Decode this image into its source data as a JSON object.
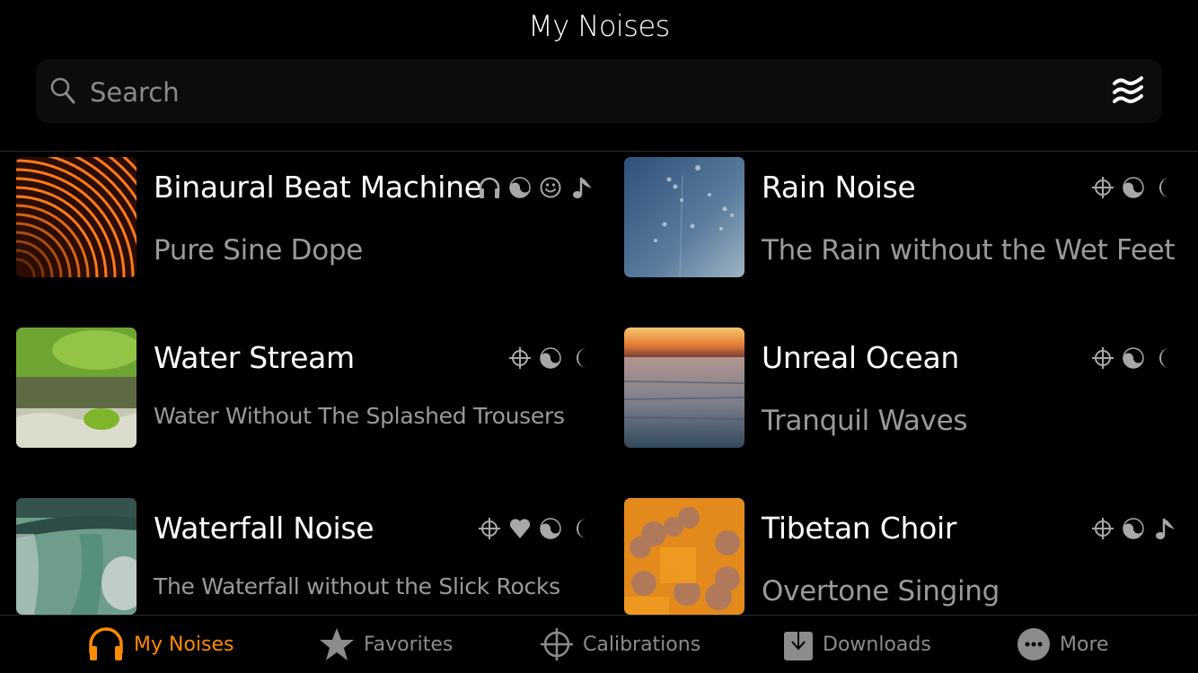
{
  "header": {
    "title": "My Noises"
  },
  "search": {
    "placeholder": "Search",
    "value": ""
  },
  "colors": {
    "accent": "#ff8a00",
    "icon_gray": "#a8a8a8",
    "subtitle_gray": "#9a9a9a",
    "tab_inactive": "#8c8c8c"
  },
  "noises": [
    {
      "name": "Binaural Beat Machine",
      "subtitle": "Pure Sine Dope",
      "thumbnail": "orange-concentric-arcs",
      "tags": [
        "headphones-icon",
        "yin-yang-icon",
        "smiley-icon",
        "music-note-icon"
      ]
    },
    {
      "name": "Rain Noise",
      "subtitle": "The Rain without the Wet Feet",
      "thumbnail": "raindrops-on-glass",
      "tags": [
        "crosshair-icon",
        "yin-yang-icon",
        "moon-icon"
      ]
    },
    {
      "name": "Water Stream",
      "subtitle": "Water Without The Splashed Trousers",
      "thumbnail": "forest-stream",
      "tags": [
        "crosshair-icon",
        "yin-yang-icon",
        "moon-icon"
      ]
    },
    {
      "name": "Unreal Ocean",
      "subtitle": "Tranquil Waves",
      "thumbnail": "ocean-sunset",
      "tags": [
        "crosshair-icon",
        "yin-yang-icon",
        "moon-icon"
      ]
    },
    {
      "name": "Waterfall Noise",
      "subtitle": "The Waterfall without the Slick Rocks",
      "thumbnail": "waterfall",
      "tags": [
        "crosshair-icon",
        "heart-icon",
        "yin-yang-icon",
        "moon-icon"
      ]
    },
    {
      "name": "Tibetan Choir",
      "subtitle": "Overtone Singing",
      "thumbnail": "monks-in-orange-robes",
      "tags": [
        "crosshair-icon",
        "yin-yang-icon",
        "music-note-icon"
      ]
    }
  ],
  "tabs": [
    {
      "label": "My Noises",
      "icon": "headphones-icon",
      "active": true
    },
    {
      "label": "Favorites",
      "icon": "star-icon",
      "active": false
    },
    {
      "label": "Calibrations",
      "icon": "crosshair-icon",
      "active": false
    },
    {
      "label": "Downloads",
      "icon": "download-icon",
      "active": false
    },
    {
      "label": "More",
      "icon": "more-icon",
      "active": false
    }
  ]
}
